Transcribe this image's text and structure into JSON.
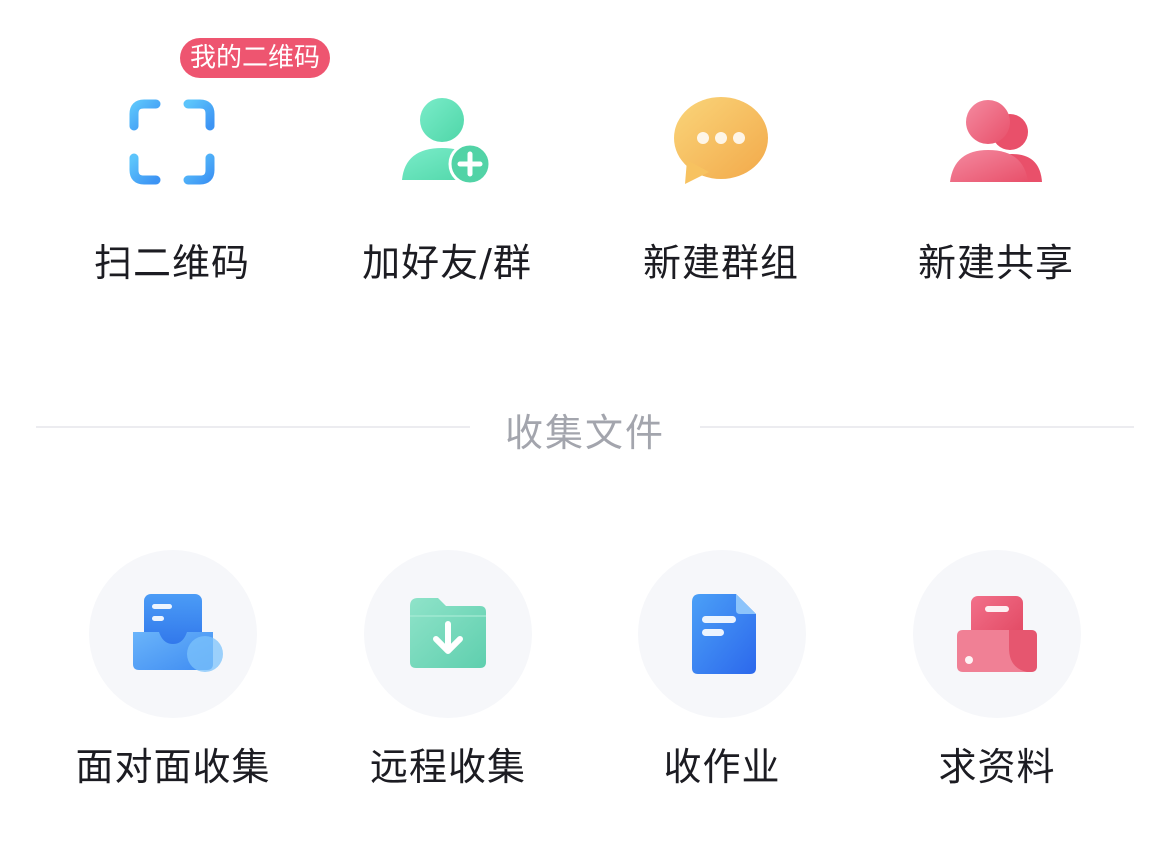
{
  "quick_actions": [
    {
      "label": "扫二维码",
      "icon": "scan-qr-icon",
      "badge": "我的二维码"
    },
    {
      "label": "加好友/群",
      "icon": "add-friend-icon"
    },
    {
      "label": "新建群组",
      "icon": "chat-bubble-icon"
    },
    {
      "label": "新建共享",
      "icon": "share-users-icon"
    }
  ],
  "section": {
    "title": "收集文件"
  },
  "collect_actions": [
    {
      "label": "面对面收集",
      "icon": "tray-document-icon"
    },
    {
      "label": "远程收集",
      "icon": "folder-download-icon"
    },
    {
      "label": "收作业",
      "icon": "document-icon"
    },
    {
      "label": "求资料",
      "icon": "printer-icon"
    }
  ],
  "colors": {
    "badge": "#ee5570",
    "scan": "#4facf7",
    "add_friend": "#5fe0b8",
    "chat": "#f6c35c",
    "share": "#ee6a80",
    "tray": "#3f8cf2",
    "folder": "#7ed9bd",
    "document": "#3b7cf5",
    "printer": "#ec5a73"
  }
}
